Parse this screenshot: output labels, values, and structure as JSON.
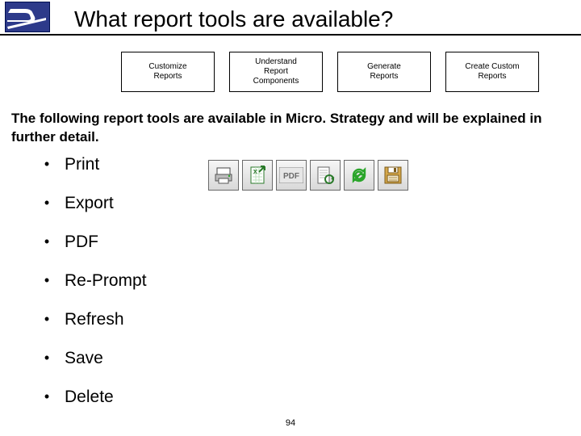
{
  "header": {
    "title": "What report tools are available?"
  },
  "tabs": [
    {
      "label": "Customize\nReports"
    },
    {
      "label": "Understand\nReport\nComponents"
    },
    {
      "label": "Generate\nReports"
    },
    {
      "label": "Create Custom\nReports"
    }
  ],
  "intro": "The following report tools are available in Micro. Strategy and will be explained in further detail.",
  "tools": [
    {
      "label": "Print"
    },
    {
      "label": "Export"
    },
    {
      "label": "PDF"
    },
    {
      "label": "Re-Prompt"
    },
    {
      "label": "Refresh"
    },
    {
      "label": "Save"
    },
    {
      "label": "Delete"
    }
  ],
  "toolbar_icons": [
    {
      "name": "print-icon"
    },
    {
      "name": "export-icon"
    },
    {
      "name": "pdf-icon"
    },
    {
      "name": "reprompt-icon"
    },
    {
      "name": "refresh-icon"
    },
    {
      "name": "save-icon"
    }
  ],
  "page_number": "94"
}
